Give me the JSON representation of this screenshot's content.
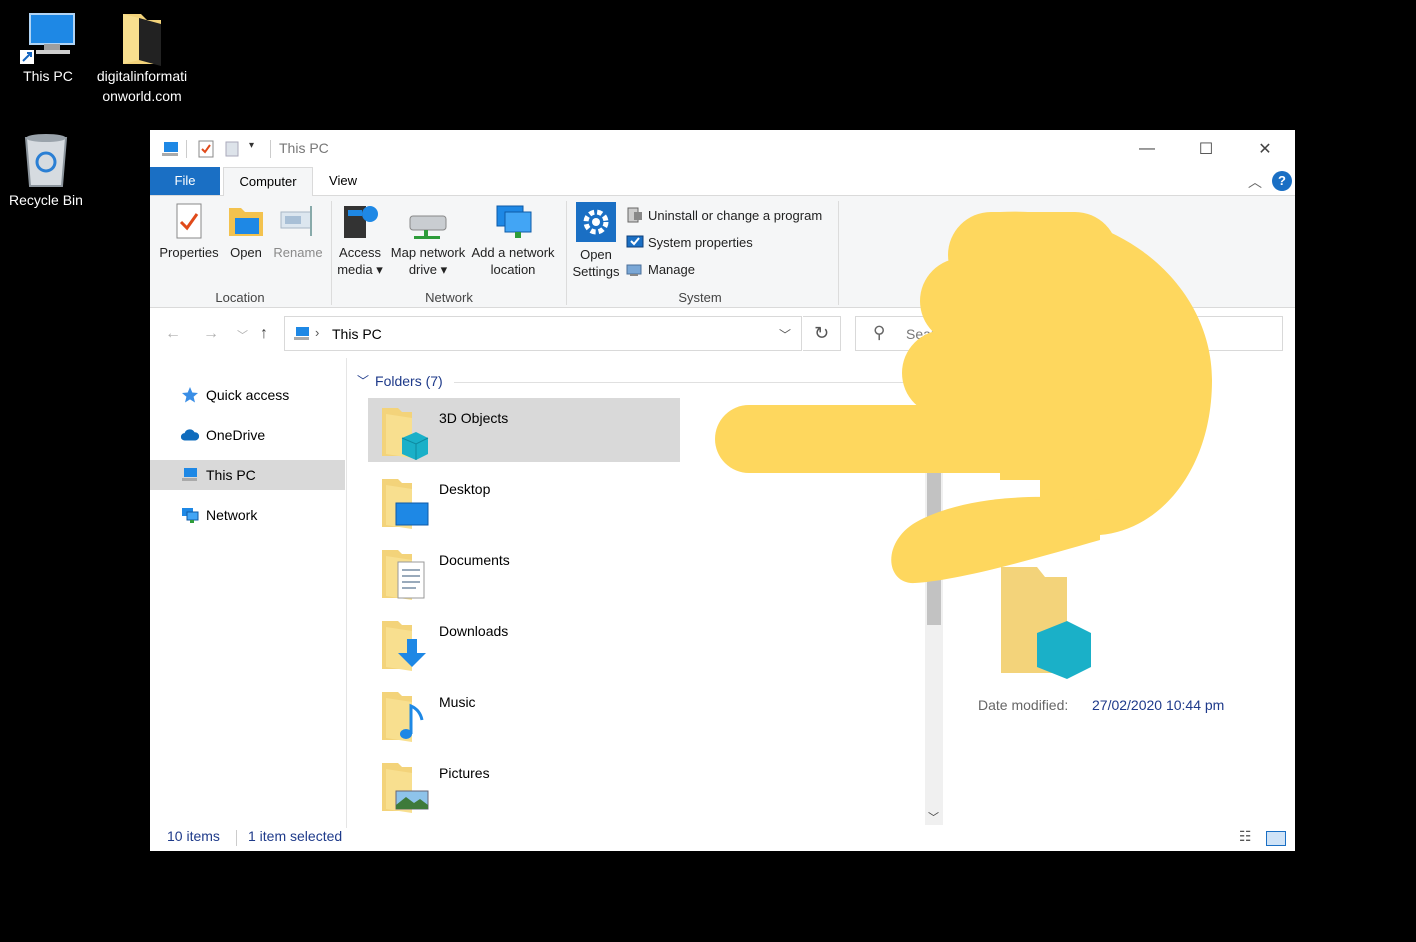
{
  "desktop": {
    "icons": [
      {
        "label": "This PC"
      },
      {
        "label": "digitalinformationworld.com"
      },
      {
        "label": "Recycle Bin"
      }
    ]
  },
  "window": {
    "title": "This PC",
    "controls": {
      "minimize": "—",
      "maximize": "☐",
      "close": "✕"
    }
  },
  "ribbon_tabs": {
    "file": "File",
    "computer": "Computer",
    "view": "View"
  },
  "ribbon": {
    "location": {
      "label": "Location",
      "properties": "Properties",
      "open": "Open",
      "rename": "Rename"
    },
    "network": {
      "label": "Network",
      "access_media": "Access media",
      "map_drive": "Map network drive",
      "add_location": "Add a network location"
    },
    "system": {
      "label": "System",
      "open_settings": "Open Settings",
      "uninstall": "Uninstall or change a program",
      "system_properties": "System properties",
      "manage": "Manage"
    }
  },
  "address": {
    "path": "This PC",
    "search_placeholder": "Sear"
  },
  "nav": {
    "items": [
      {
        "label": "Quick access"
      },
      {
        "label": "OneDrive"
      },
      {
        "label": "This PC"
      },
      {
        "label": "Network"
      }
    ]
  },
  "content": {
    "group_header": "Folders (7)",
    "folders": [
      {
        "name": "3D Objects"
      },
      {
        "name": "Desktop"
      },
      {
        "name": "Documents"
      },
      {
        "name": "Downloads"
      },
      {
        "name": "Music"
      },
      {
        "name": "Pictures"
      }
    ]
  },
  "preview": {
    "date_label": "Date modified:",
    "date_value": "27/02/2020 10:44 pm"
  },
  "status": {
    "items": "10 items",
    "selected": "1 item selected"
  }
}
